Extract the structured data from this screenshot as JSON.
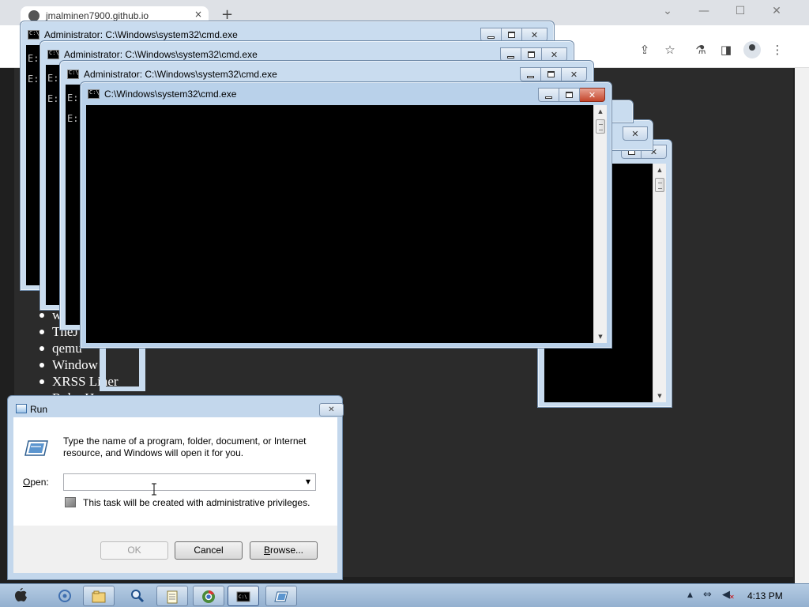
{
  "browser": {
    "tab_title": "jmalminen7900.github.io",
    "tab_close": "×",
    "new_tab": "+",
    "controls": {
      "menu": "⌄",
      "minimize": "—",
      "maximize": "☐",
      "close": "✕"
    },
    "toolbar_icons": {
      "share": "⇪",
      "bookmark": "☆",
      "extensions": "⚗",
      "sidepanel": "◨",
      "menu": "⋮"
    },
    "list_items": [
      "w",
      "TheJ",
      "qemu",
      "Window",
      "XRSS Liner",
      "Ruby H"
    ]
  },
  "cmd_windows": [
    {
      "title": "Administrator: C:\\Windows\\system32\\cmd.exe",
      "lines": [
        "E:",
        "E:"
      ]
    },
    {
      "title": "Administrator: C:\\Windows\\system32\\cmd.exe",
      "lines": [
        "E:",
        "E:"
      ]
    },
    {
      "title": "Administrator: C:\\Windows\\system32\\cmd.exe",
      "lines": [
        "E:",
        "E:"
      ]
    },
    {
      "title": "C:\\Windows\\system32\\cmd.exe",
      "lines": []
    }
  ],
  "window_buttons": {
    "close": "✕",
    "scroll_up": "▲",
    "scroll_down": "▼"
  },
  "run": {
    "title": "Run",
    "description": "Type the name of a program, folder, document, or Internet resource, and Windows will open it for you.",
    "open_label_prefix": "",
    "open_label_underlined": "O",
    "open_label_rest": "pen:",
    "open_value": "",
    "dropdown": "▼",
    "admin_note": "This task will be created with administrative privileges.",
    "ok_label": "OK",
    "cancel_label": "Cancel",
    "browse_label_underlined": "B",
    "browse_label_rest": "rowse..."
  },
  "taskbar": {
    "clock": "4:13 PM"
  },
  "colors": {
    "desktop": "#2b2b2b",
    "console_bg": "#000000",
    "title_active": "#b9d1ea",
    "close_red": "#c4452b"
  }
}
